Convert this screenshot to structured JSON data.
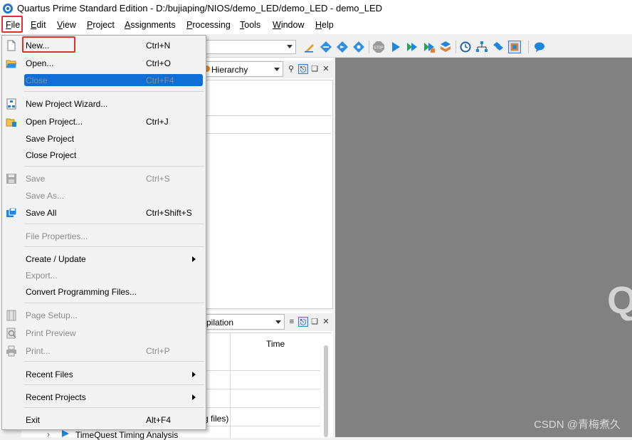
{
  "window": {
    "title": "Quartus Prime Standard Edition - D:/bujiaping/NIOS/demo_LED/demo_LED - demo_LED"
  },
  "menubar": {
    "items": [
      "File",
      "Edit",
      "View",
      "Project",
      "Assignments",
      "Processing",
      "Tools",
      "Window",
      "Help"
    ]
  },
  "project_navigator": {
    "dropdown_label": "Hierarchy"
  },
  "tasks": {
    "dropdown_label": "pilation",
    "column_time": "Time",
    "partial_row_text": "g files)",
    "partial_bottom_text": "TimeQuest Timing Analysis"
  },
  "file_menu": {
    "items": [
      {
        "label": "New...",
        "shortcut": "Ctrl+N",
        "enabled": true,
        "selected": true,
        "icon": "new-file-icon"
      },
      {
        "label": "Open...",
        "shortcut": "Ctrl+O",
        "enabled": true,
        "icon": "open-folder-icon"
      },
      {
        "label": "Close",
        "shortcut": "Ctrl+F4",
        "enabled": false
      },
      {
        "label": "New Project Wizard...",
        "shortcut": "",
        "enabled": true,
        "icon": "project-wizard-icon"
      },
      {
        "label": "Open Project...",
        "shortcut": "Ctrl+J",
        "enabled": true,
        "icon": "open-project-icon"
      },
      {
        "label": "Save Project",
        "shortcut": "",
        "enabled": true
      },
      {
        "label": "Close Project",
        "shortcut": "",
        "enabled": true
      },
      {
        "label": "Save",
        "shortcut": "Ctrl+S",
        "enabled": false,
        "icon": "save-icon"
      },
      {
        "label": "Save As...",
        "shortcut": "",
        "enabled": false
      },
      {
        "label": "Save All",
        "shortcut": "Ctrl+Shift+S",
        "enabled": true,
        "icon": "save-all-icon"
      },
      {
        "label": "File Properties...",
        "shortcut": "",
        "enabled": false
      },
      {
        "label": "Create / Update",
        "shortcut": "",
        "enabled": true,
        "submenu": true
      },
      {
        "label": "Export...",
        "shortcut": "",
        "enabled": false
      },
      {
        "label": "Convert Programming Files...",
        "shortcut": "",
        "enabled": true
      },
      {
        "label": "Page Setup...",
        "shortcut": "",
        "enabled": false,
        "icon": "page-setup-icon"
      },
      {
        "label": "Print Preview",
        "shortcut": "",
        "enabled": false,
        "icon": "print-preview-icon"
      },
      {
        "label": "Print...",
        "shortcut": "Ctrl+P",
        "enabled": false,
        "icon": "print-icon"
      },
      {
        "label": "Recent Files",
        "shortcut": "",
        "enabled": true,
        "submenu": true
      },
      {
        "label": "Recent Projects",
        "shortcut": "",
        "enabled": true,
        "submenu": true
      },
      {
        "label": "Exit",
        "shortcut": "Alt+F4",
        "enabled": true
      }
    ]
  },
  "watermark": "CSDN @青梅煮久",
  "workarea_letter": "Q",
  "colors": {
    "highlight_red": "#e0302c",
    "selection_blue": "#0f6fd6",
    "workarea_gray": "#818181"
  }
}
